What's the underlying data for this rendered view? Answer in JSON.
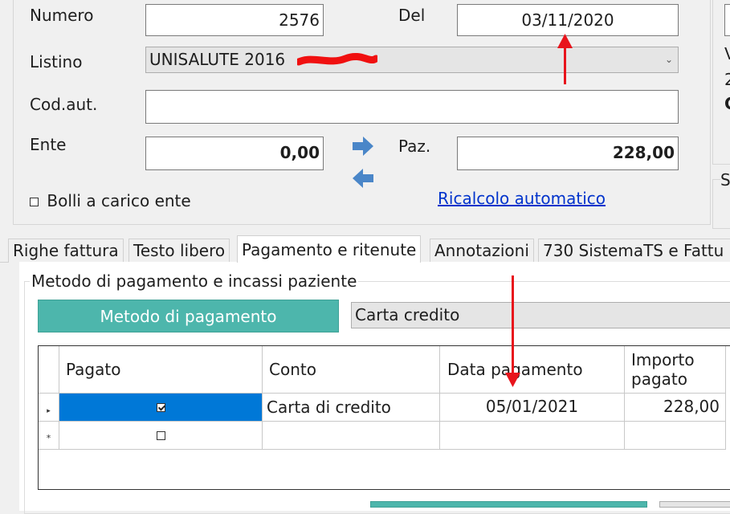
{
  "colors": {
    "accent_teal": "#4db6ac",
    "selection_blue": "#0078d7",
    "annotation_red": "#e8141c",
    "link_blue": "#0033cc"
  },
  "header": {
    "numero_label": "Numero",
    "numero_value": "2576",
    "del_label": "Del",
    "del_value": "03/11/2020",
    "listino_label": "Listino",
    "listino_value": "UNISALUTE 2016",
    "codaut_label": "Cod.aut.",
    "codaut_value": "",
    "ente_label": "Ente",
    "ente_value": "0,00",
    "paz_label": "Paz.",
    "paz_value": "228,00",
    "bolli_label": "Bolli a carico ente",
    "bolli_checked": false,
    "ricalcolo_link": "Ricalcolo automatico",
    "arrow_right_icon": "arrow-right-icon",
    "arrow_left_icon": "arrow-left-icon"
  },
  "right_panel": {
    "line1": "V",
    "line2": "2",
    "line3": "C",
    "line4": "S"
  },
  "tabs": [
    {
      "label": "Righe fattura",
      "active": false
    },
    {
      "label": "Testo libero",
      "active": false
    },
    {
      "label": "Pagamento e ritenute",
      "active": true
    },
    {
      "label": "Annotazioni",
      "active": false
    },
    {
      "label": "730 SistemaTS e Fattu",
      "active": false
    }
  ],
  "payment": {
    "group_title": "Metodo di pagamento e incassi paziente",
    "method_button": "Metodo di pagamento",
    "method_value": "Carta credito",
    "grid": {
      "columns": [
        "Pagato",
        "Conto",
        "Data pagamento",
        "Importo\npagato"
      ],
      "rows": [
        {
          "pagato": true,
          "conto": "Carta di credito",
          "data": "05/01/2021",
          "importo": "228,00",
          "marker": "▸"
        },
        {
          "pagato": false,
          "conto": "",
          "data": "",
          "importo": "",
          "marker": "*"
        }
      ]
    }
  }
}
